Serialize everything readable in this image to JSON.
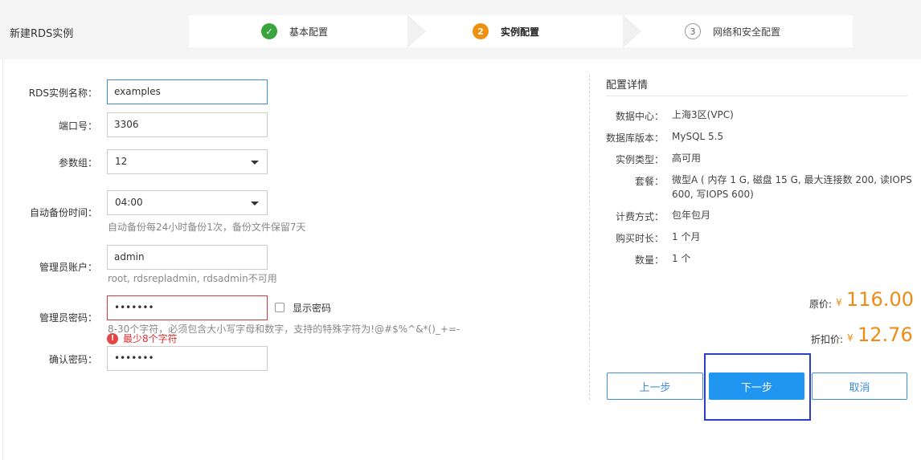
{
  "page": {
    "title": "新建RDS实例"
  },
  "steps": [
    {
      "number": "✓",
      "label": "基本配置",
      "state": "done"
    },
    {
      "number": "2",
      "label": "实例配置",
      "state": "active"
    },
    {
      "number": "3",
      "label": "网络和安全配置",
      "state": "todo"
    }
  ],
  "form": {
    "instance_name": {
      "label": "RDS实例名称：",
      "value": "examples"
    },
    "port": {
      "label": "端口号：",
      "value": "3306"
    },
    "param_group": {
      "label": "参数组：",
      "value": "12"
    },
    "backup_time": {
      "label": "自动备份时间：",
      "value": "04:00",
      "hint": "自动备份每24小时备份1次，备份文件保留7天"
    },
    "admin_account": {
      "label": "管理员账户：",
      "value": "admin",
      "hint": "root, rdsrepladmin, rdsadmin不可用"
    },
    "admin_password": {
      "label": "管理员密码：",
      "value": "•••••••",
      "show_password_label": "显示密码",
      "hint": "8-30个字符，必须包含大小写字母和数字，支持的特殊字符为!@#$%^&*()_+=-",
      "error": "最少8个字符",
      "error_icon": "!"
    },
    "confirm_password": {
      "label": "确认密码：",
      "value": "•••••••"
    }
  },
  "summary": {
    "title": "配置详情",
    "rows": [
      {
        "label": "数据中心：",
        "value": "上海3区(VPC)"
      },
      {
        "label": "数据库版本：",
        "value": "MySQL 5.5"
      },
      {
        "label": "实例类型：",
        "value": "高可用"
      },
      {
        "label": "套餐：",
        "value": "微型A ( 内存 1 G, 磁盘 15 G, 最大连接数 200, 读IOPS 600, 写IOPS 600)"
      },
      {
        "label": "计费方式：",
        "value": "包年包月"
      },
      {
        "label": "购买时长：",
        "value": "1 个月"
      },
      {
        "label": "数量：",
        "value": "1 个"
      }
    ],
    "original_price": {
      "label": "原价:",
      "currency": "¥",
      "value": "116.00"
    },
    "discount_price": {
      "label": "折扣价:",
      "currency": "¥",
      "value": "12.76"
    }
  },
  "buttons": {
    "prev": "上一步",
    "next": "下一步",
    "cancel": "取消"
  },
  "colors": {
    "accent": "#2196f0",
    "price": "#ef8a14",
    "error": "#d93a3a",
    "step_done": "#3aa53f",
    "step_active": "#f0900f"
  }
}
